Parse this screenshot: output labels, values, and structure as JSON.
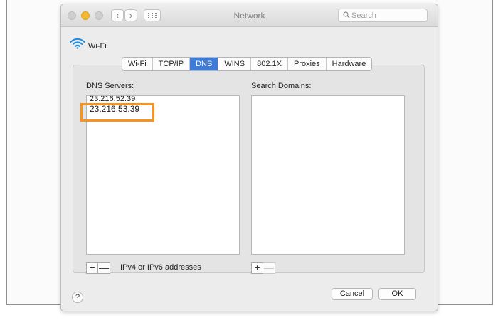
{
  "window": {
    "title": "Network"
  },
  "search": {
    "placeholder": "Search",
    "value": ""
  },
  "interface": {
    "name": "Wi-Fi"
  },
  "tabs": [
    {
      "label": "Wi-Fi",
      "active": false
    },
    {
      "label": "TCP/IP",
      "active": false
    },
    {
      "label": "DNS",
      "active": true
    },
    {
      "label": "WINS",
      "active": false
    },
    {
      "label": "802.1X",
      "active": false
    },
    {
      "label": "Proxies",
      "active": false
    },
    {
      "label": "Hardware",
      "active": false
    }
  ],
  "dns_servers": {
    "label": "DNS Servers:",
    "items": [
      "23.216.52.39",
      "23.216.53.39"
    ],
    "add_label": "+",
    "remove_label": "—",
    "hint": "IPv4 or IPv6 addresses"
  },
  "search_domains": {
    "label": "Search Domains:",
    "items": [],
    "add_label": "+",
    "remove_label": "—"
  },
  "footer": {
    "help_label": "?",
    "cancel_label": "Cancel",
    "ok_label": "OK"
  },
  "colors": {
    "accent_tab": "#3d7bd9",
    "highlight": "#f7941d",
    "minimize_light": "#f5b92d"
  }
}
